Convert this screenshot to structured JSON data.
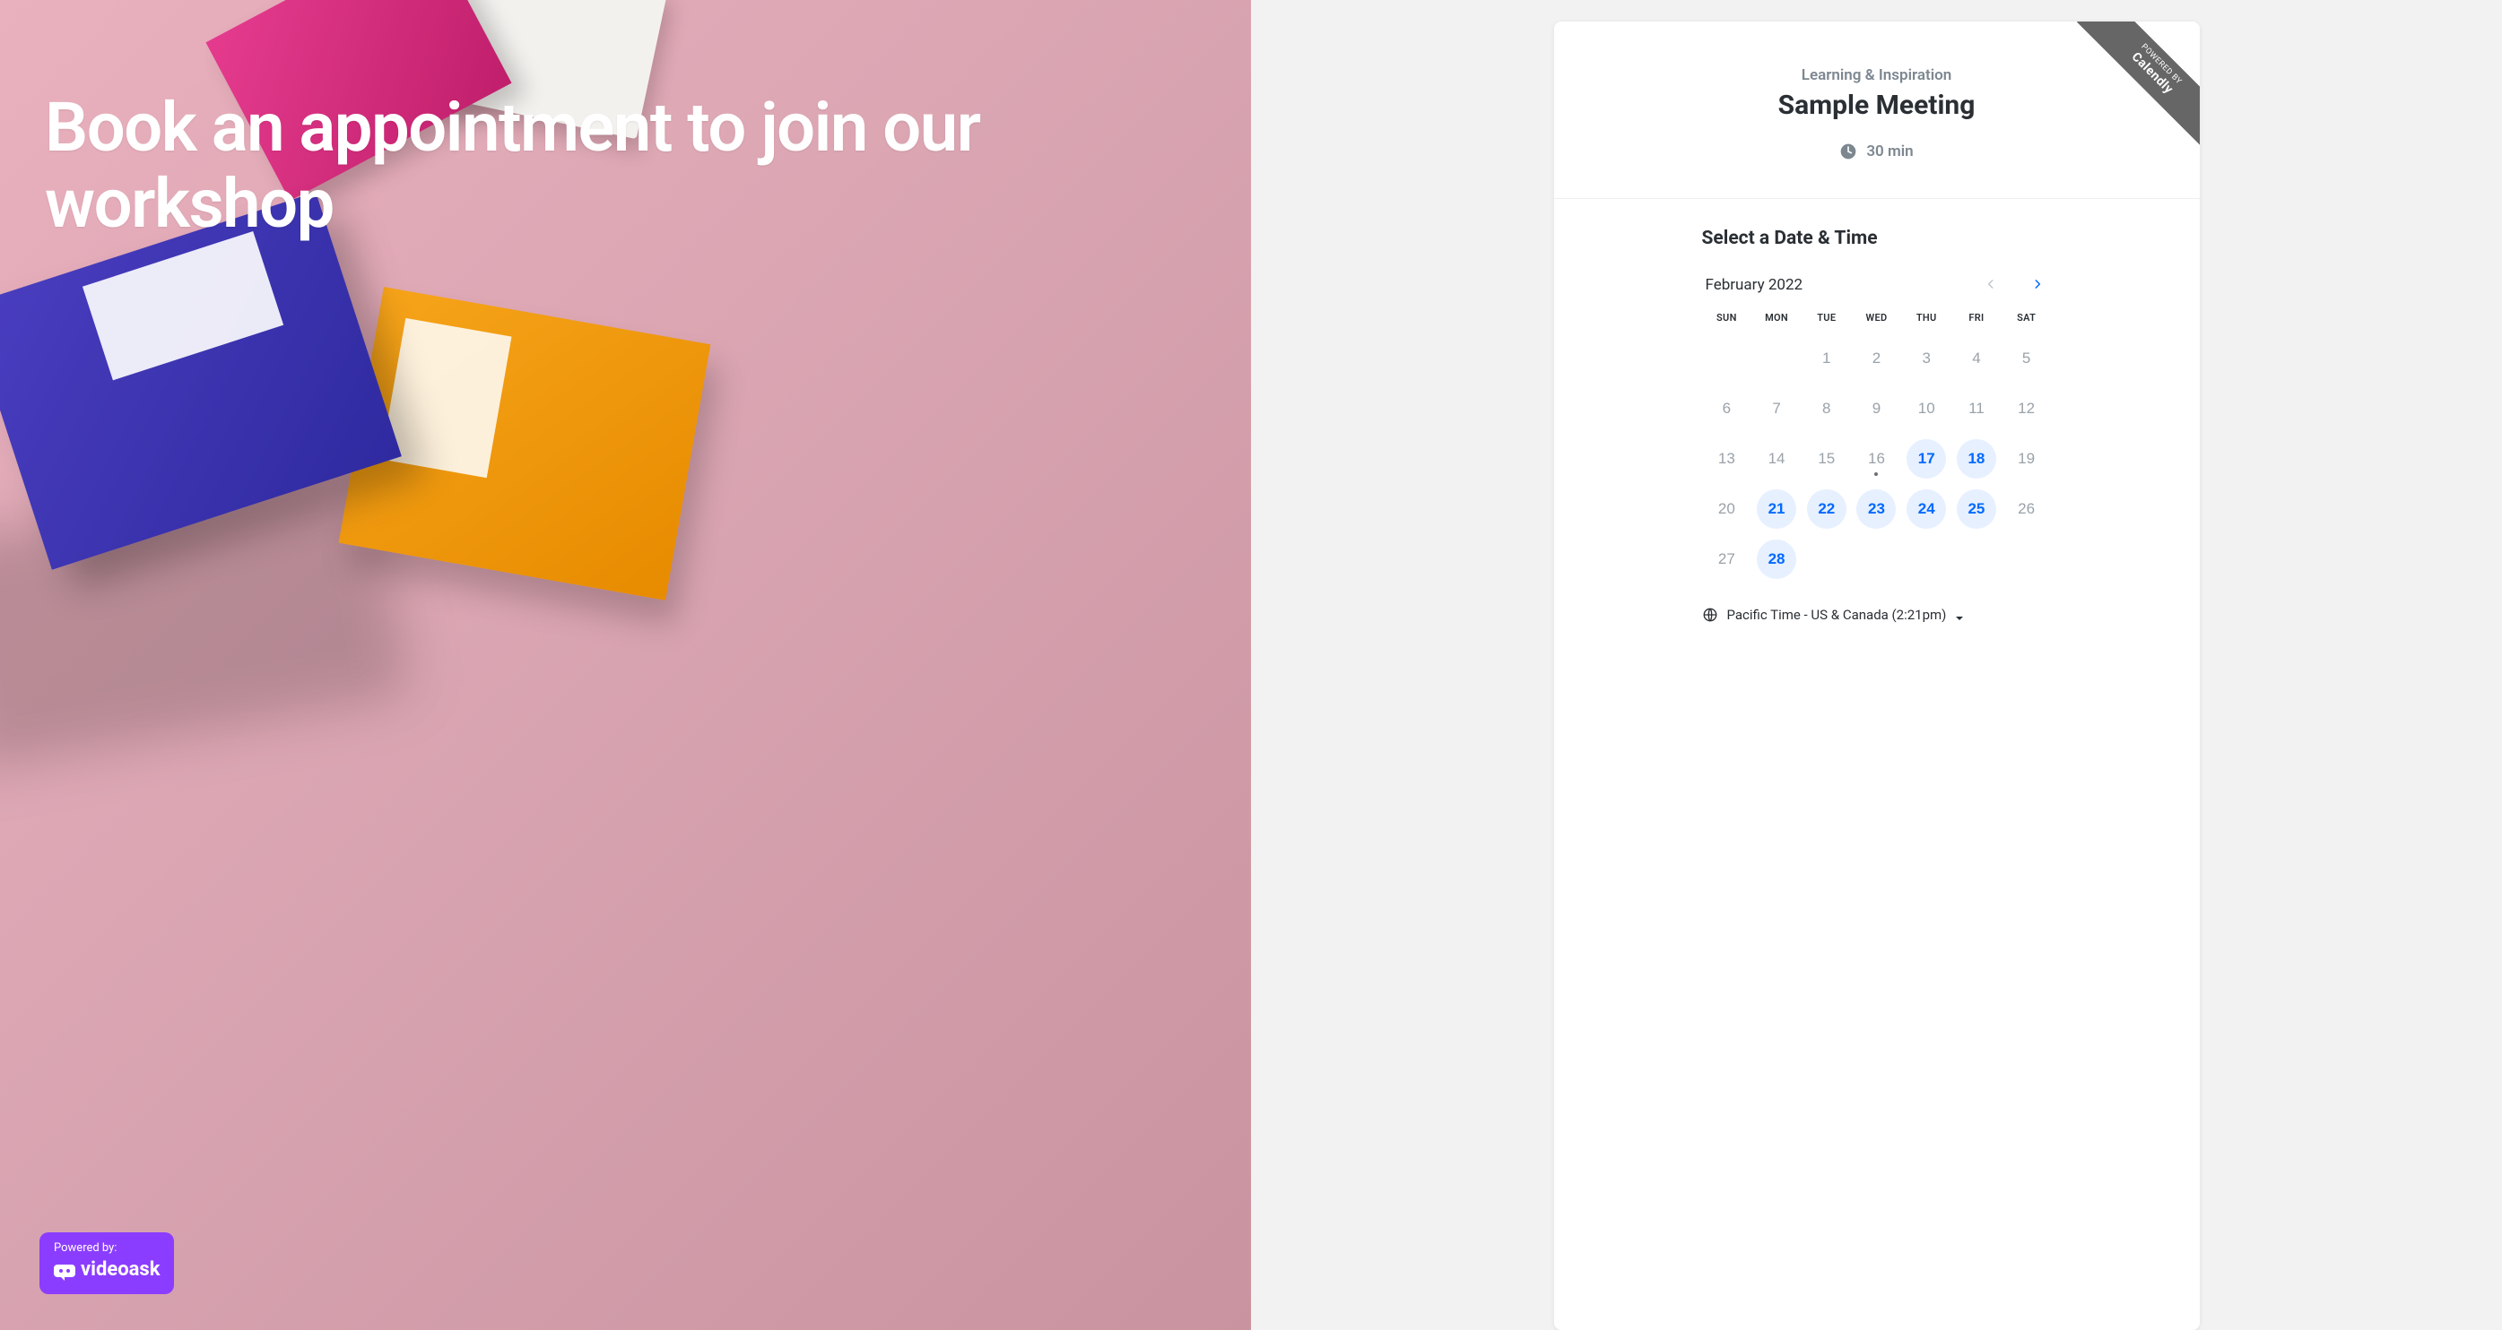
{
  "hero": {
    "title": "Book an appointment to join our workshop"
  },
  "videoask": {
    "powered_by": "Powered by:",
    "brand": "videoask"
  },
  "calendly_ribbon": {
    "powered_by": "POWERED BY",
    "brand": "Calendly"
  },
  "header": {
    "org": "Learning & Inspiration",
    "title": "Sample Meeting",
    "duration": "30 min"
  },
  "body": {
    "select_title": "Select a Date & Time",
    "month_label": "February 2022",
    "dow": [
      "SUN",
      "MON",
      "TUE",
      "WED",
      "THU",
      "FRI",
      "SAT"
    ],
    "weeks": [
      [
        {
          "n": "",
          "a": false
        },
        {
          "n": "",
          "a": false
        },
        {
          "n": "1",
          "a": false
        },
        {
          "n": "2",
          "a": false
        },
        {
          "n": "3",
          "a": false
        },
        {
          "n": "4",
          "a": false
        },
        {
          "n": "5",
          "a": false
        }
      ],
      [
        {
          "n": "6",
          "a": false
        },
        {
          "n": "7",
          "a": false
        },
        {
          "n": "8",
          "a": false
        },
        {
          "n": "9",
          "a": false
        },
        {
          "n": "10",
          "a": false
        },
        {
          "n": "11",
          "a": false
        },
        {
          "n": "12",
          "a": false
        }
      ],
      [
        {
          "n": "13",
          "a": false
        },
        {
          "n": "14",
          "a": false
        },
        {
          "n": "15",
          "a": false
        },
        {
          "n": "16",
          "a": false,
          "today": true
        },
        {
          "n": "17",
          "a": true
        },
        {
          "n": "18",
          "a": true
        },
        {
          "n": "19",
          "a": false
        }
      ],
      [
        {
          "n": "20",
          "a": false
        },
        {
          "n": "21",
          "a": true
        },
        {
          "n": "22",
          "a": true
        },
        {
          "n": "23",
          "a": true
        },
        {
          "n": "24",
          "a": true
        },
        {
          "n": "25",
          "a": true
        },
        {
          "n": "26",
          "a": false
        }
      ],
      [
        {
          "n": "27",
          "a": false
        },
        {
          "n": "28",
          "a": true
        },
        {
          "n": "",
          "a": false
        },
        {
          "n": "",
          "a": false
        },
        {
          "n": "",
          "a": false
        },
        {
          "n": "",
          "a": false
        },
        {
          "n": "",
          "a": false
        }
      ]
    ],
    "timezone": "Pacific Time - US & Canada (2:21pm)"
  }
}
